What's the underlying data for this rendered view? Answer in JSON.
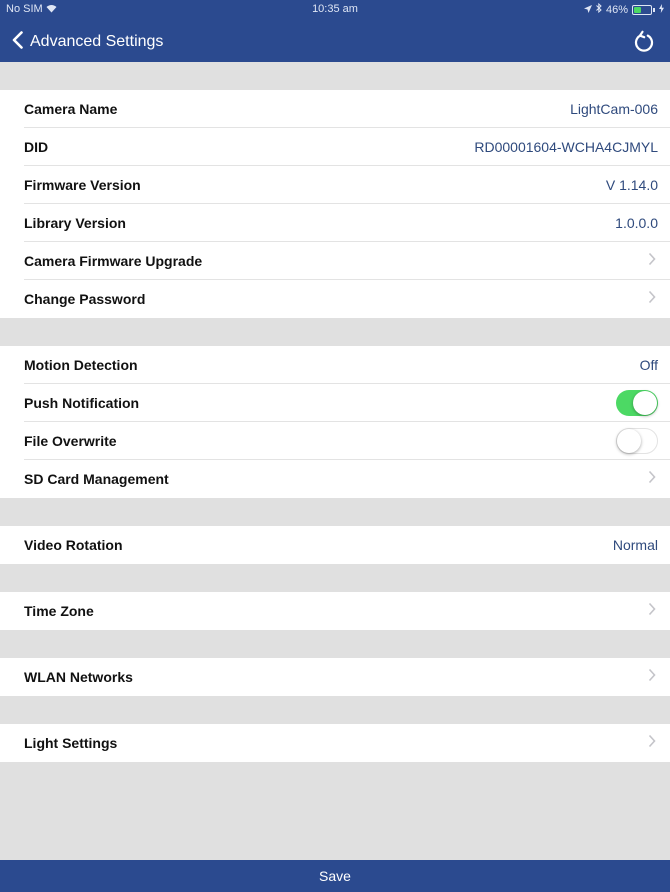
{
  "status": {
    "carrier": "No SIM",
    "time": "10:35 am",
    "battery_text": "46%",
    "battery_level": 0.46
  },
  "nav": {
    "back_label": "Advanced Settings",
    "refresh_icon": "refresh-icon"
  },
  "sections": {
    "info": {
      "camera_name": {
        "label": "Camera Name",
        "value": "LightCam-006"
      },
      "did": {
        "label": "DID",
        "value": "RD00001604-WCHA4CJMYL"
      },
      "firmware": {
        "label": "Firmware Version",
        "value": "V 1.14.0"
      },
      "library": {
        "label": "Library Version",
        "value": "1.0.0.0"
      },
      "upgrade": {
        "label": "Camera Firmware Upgrade"
      },
      "password": {
        "label": "Change Password"
      }
    },
    "detection": {
      "motion": {
        "label": "Motion Detection",
        "value": "Off"
      },
      "push": {
        "label": "Push Notification",
        "on": true
      },
      "overwrite": {
        "label": "File Overwrite",
        "on": false
      },
      "sdcard": {
        "label": "SD Card Management"
      }
    },
    "video": {
      "rotation": {
        "label": "Video Rotation",
        "value": "Normal"
      }
    },
    "time": {
      "zone": {
        "label": "Time Zone"
      }
    },
    "wlan": {
      "networks": {
        "label": "WLAN Networks"
      }
    },
    "light": {
      "settings": {
        "label": "Light Settings"
      }
    }
  },
  "footer": {
    "save_label": "Save"
  },
  "colors": {
    "nav_bg": "#2b4a8f",
    "value_text": "#2f4a7d",
    "toggle_on": "#4cd964",
    "page_bg": "#e0e0e0"
  }
}
